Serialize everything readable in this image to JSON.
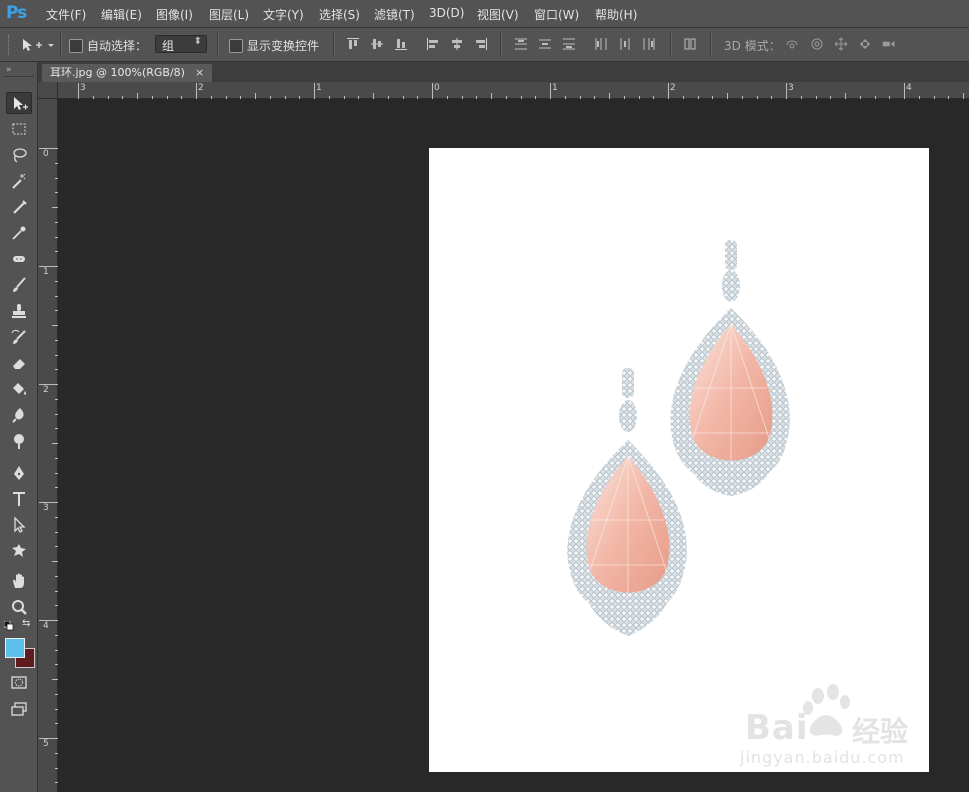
{
  "app": {
    "logo": "Ps"
  },
  "menu": [
    "文件(F)",
    "编辑(E)",
    "图像(I)",
    "图层(L)",
    "文字(Y)",
    "选择(S)",
    "滤镜(T)",
    "3D(D)",
    "视图(V)",
    "窗口(W)",
    "帮助(H)"
  ],
  "options": {
    "auto_select_label": "自动选择：",
    "group_value": "组",
    "show_transform_label": "显示变换控件",
    "mode_3d_label": "3D 模式："
  },
  "document_tab": {
    "title": "耳环.jpg @ 100%(RGB/8)",
    "close": "×"
  },
  "ruler": {
    "horizontal": [
      "3",
      "2",
      "1",
      "0",
      "1",
      "2",
      "3",
      "4"
    ],
    "vertical": [
      "0",
      "1",
      "2",
      "3",
      "4",
      "5"
    ]
  },
  "colors": {
    "foreground": "#5bc1ea",
    "background": "#5e1b20",
    "accent": "#3fa0e6"
  },
  "tools": [
    "move-tool",
    "marquee-tool",
    "lasso-tool",
    "magic-wand-tool",
    "crop-tool",
    "eyedropper-tool",
    "healing-brush-tool",
    "brush-tool",
    "clone-stamp-tool",
    "history-brush-tool",
    "eraser-tool",
    "paint-bucket-tool",
    "blur-tool",
    "dodge-tool",
    "pen-tool",
    "type-tool",
    "path-selection-tool",
    "shape-tool",
    "hand-tool",
    "zoom-tool"
  ],
  "watermark": {
    "brand_left": "Bai",
    "brand_right": "经验",
    "url": "jingyan.baidu.com"
  }
}
